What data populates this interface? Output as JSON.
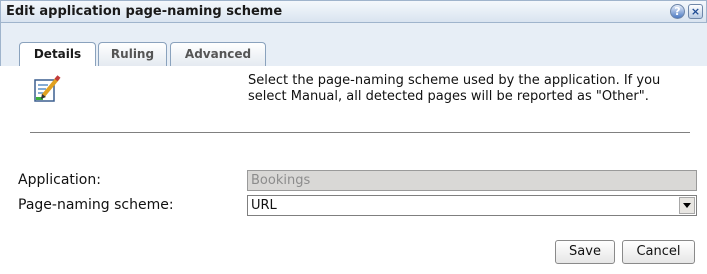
{
  "dialog": {
    "title": "Edit application page-naming scheme",
    "help_label": "?",
    "close_label": "×"
  },
  "tabs": [
    {
      "label": "Details",
      "active": true
    },
    {
      "label": "Ruling",
      "active": false
    },
    {
      "label": "Advanced",
      "active": false
    }
  ],
  "details": {
    "icon": "edit-document-icon",
    "description": "Select the page-naming scheme used by the application. If you select Manual, all detected pages will be reported as \"Other\"."
  },
  "form": {
    "application_label": "Application:",
    "application_value": "Bookings",
    "scheme_label": "Page-naming scheme:",
    "scheme_value": "URL"
  },
  "buttons": {
    "save": "Save",
    "cancel": "Cancel"
  },
  "colors": {
    "titlebar": "#d9e4f0",
    "tabstrip": "#e7eef6",
    "disabled_field": "#d9d8d6"
  }
}
